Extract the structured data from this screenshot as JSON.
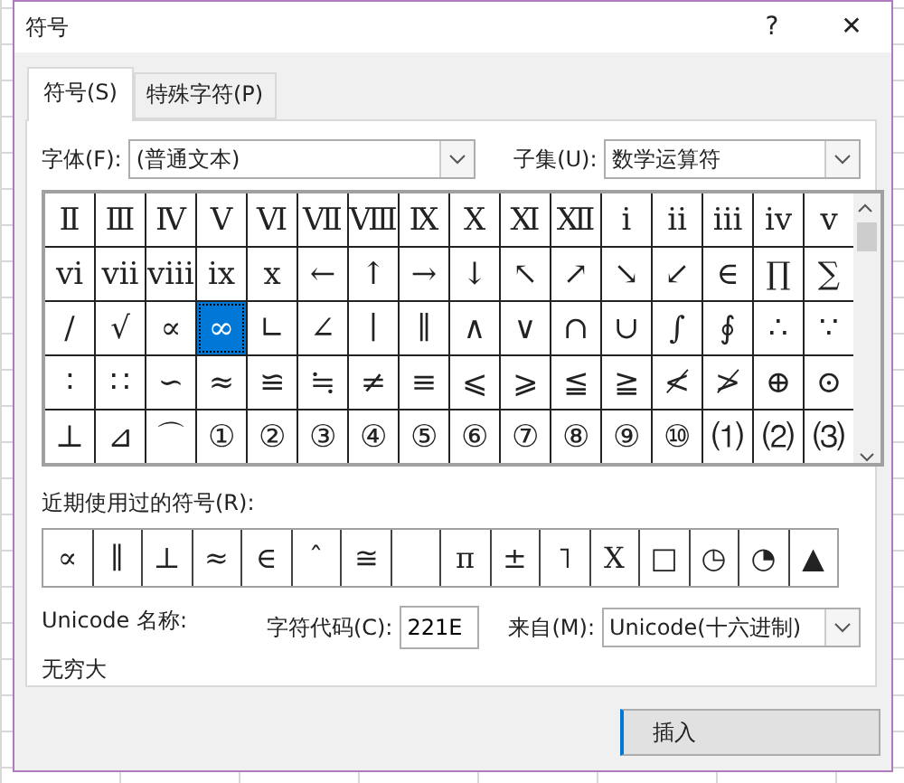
{
  "window": {
    "title": "符号",
    "help": "?",
    "close": "✕"
  },
  "tabs": [
    {
      "label": "符号(S)",
      "selected": true
    },
    {
      "label": "特殊字符(P)",
      "selected": false
    }
  ],
  "font": {
    "label": "字体(F):",
    "value": "(普通文本)"
  },
  "subset": {
    "label": "子集(U):",
    "value": "数学运算符"
  },
  "symbols": [
    {
      "symbol": "Ⅱ",
      "selected": false
    },
    {
      "symbol": "Ⅲ",
      "selected": false
    },
    {
      "symbol": "Ⅳ",
      "selected": false
    },
    {
      "symbol": "Ⅴ",
      "selected": false
    },
    {
      "symbol": "Ⅵ",
      "selected": false
    },
    {
      "symbol": "Ⅶ",
      "selected": false
    },
    {
      "symbol": "Ⅷ",
      "selected": false
    },
    {
      "symbol": "Ⅸ",
      "selected": false
    },
    {
      "symbol": "Ⅹ",
      "selected": false
    },
    {
      "symbol": "Ⅺ",
      "selected": false
    },
    {
      "symbol": "Ⅻ",
      "selected": false
    },
    {
      "symbol": "ⅰ",
      "selected": false
    },
    {
      "symbol": "ⅱ",
      "selected": false
    },
    {
      "symbol": "ⅲ",
      "selected": false
    },
    {
      "symbol": "ⅳ",
      "selected": false
    },
    {
      "symbol": "ⅴ",
      "selected": false
    },
    {
      "symbol": "ⅵ",
      "selected": false
    },
    {
      "symbol": "ⅶ",
      "selected": false
    },
    {
      "symbol": "ⅷ",
      "selected": false
    },
    {
      "symbol": "ⅸ",
      "selected": false
    },
    {
      "symbol": "ⅹ",
      "selected": false
    },
    {
      "symbol": "←",
      "selected": false
    },
    {
      "symbol": "↑",
      "selected": false
    },
    {
      "symbol": "→",
      "selected": false
    },
    {
      "symbol": "↓",
      "selected": false
    },
    {
      "symbol": "↖",
      "selected": false
    },
    {
      "symbol": "↗",
      "selected": false
    },
    {
      "symbol": "↘",
      "selected": false
    },
    {
      "symbol": "↙",
      "selected": false
    },
    {
      "symbol": "∈",
      "selected": false
    },
    {
      "symbol": "∏",
      "selected": false
    },
    {
      "symbol": "∑",
      "selected": false
    },
    {
      "symbol": "∕",
      "selected": false
    },
    {
      "symbol": "√",
      "selected": false
    },
    {
      "symbol": "∝",
      "selected": false
    },
    {
      "symbol": "∞",
      "selected": true
    },
    {
      "symbol": "∟",
      "selected": false
    },
    {
      "symbol": "∠",
      "selected": false
    },
    {
      "symbol": "∣",
      "selected": false
    },
    {
      "symbol": "∥",
      "selected": false
    },
    {
      "symbol": "∧",
      "selected": false
    },
    {
      "symbol": "∨",
      "selected": false
    },
    {
      "symbol": "∩",
      "selected": false
    },
    {
      "symbol": "∪",
      "selected": false
    },
    {
      "symbol": "∫",
      "selected": false
    },
    {
      "symbol": "∮",
      "selected": false
    },
    {
      "symbol": "∴",
      "selected": false
    },
    {
      "symbol": "∵",
      "selected": false
    },
    {
      "symbol": "∶",
      "selected": false
    },
    {
      "symbol": "∷",
      "selected": false
    },
    {
      "symbol": "∽",
      "selected": false
    },
    {
      "symbol": "≈",
      "selected": false
    },
    {
      "symbol": "≌",
      "selected": false
    },
    {
      "symbol": "≒",
      "selected": false
    },
    {
      "symbol": "≠",
      "selected": false
    },
    {
      "symbol": "≡",
      "selected": false
    },
    {
      "symbol": "⩽",
      "selected": false
    },
    {
      "symbol": "⩾",
      "selected": false
    },
    {
      "symbol": "≦",
      "selected": false
    },
    {
      "symbol": "≧",
      "selected": false
    },
    {
      "symbol": "≮",
      "selected": false
    },
    {
      "symbol": "≯",
      "selected": false
    },
    {
      "symbol": "⊕",
      "selected": false
    },
    {
      "symbol": "⊙",
      "selected": false
    },
    {
      "symbol": "⊥",
      "selected": false
    },
    {
      "symbol": "⊿",
      "selected": false
    },
    {
      "symbol": "⌒",
      "selected": false
    },
    {
      "symbol": "①",
      "selected": false
    },
    {
      "symbol": "②",
      "selected": false
    },
    {
      "symbol": "③",
      "selected": false
    },
    {
      "symbol": "④",
      "selected": false
    },
    {
      "symbol": "⑤",
      "selected": false
    },
    {
      "symbol": "⑥",
      "selected": false
    },
    {
      "symbol": "⑦",
      "selected": false
    },
    {
      "symbol": "⑧",
      "selected": false
    },
    {
      "symbol": "⑨",
      "selected": false
    },
    {
      "symbol": "⑩",
      "selected": false
    },
    {
      "symbol": "⑴",
      "selected": false
    },
    {
      "symbol": "⑵",
      "selected": false
    },
    {
      "symbol": "⑶",
      "selected": false
    }
  ],
  "recent": {
    "label": "近期使用过的符号(R):",
    "items": [
      {
        "kind": "glyph",
        "symbol": "∝"
      },
      {
        "kind": "glyph",
        "symbol": "∥"
      },
      {
        "kind": "glyph",
        "symbol": "⊥"
      },
      {
        "kind": "glyph",
        "symbol": "≈"
      },
      {
        "kind": "glyph",
        "symbol": "∈"
      },
      {
        "kind": "glyph",
        "symbol": "ˆ"
      },
      {
        "kind": "glyph",
        "symbol": "≅"
      },
      {
        "kind": "blank"
      },
      {
        "kind": "glyph",
        "symbol": "π"
      },
      {
        "kind": "glyph",
        "symbol": "±"
      },
      {
        "kind": "glyph",
        "symbol": "˥"
      },
      {
        "kind": "glyph",
        "symbol": "Χ"
      },
      {
        "kind": "glyph",
        "symbol": "□"
      },
      {
        "kind": "glyph",
        "symbol": "◷"
      },
      {
        "kind": "glyph",
        "symbol": "◔"
      },
      {
        "kind": "glyph",
        "symbol": "▲"
      }
    ]
  },
  "unicode_name": {
    "label": "Unicode 名称:",
    "value": "无穷大"
  },
  "char_code": {
    "label": "字符代码(C):",
    "value": "221E"
  },
  "from": {
    "label": "来自(M):",
    "value": "Unicode(十六进制)"
  },
  "buttons": [
    {
      "label": "插入"
    }
  ]
}
